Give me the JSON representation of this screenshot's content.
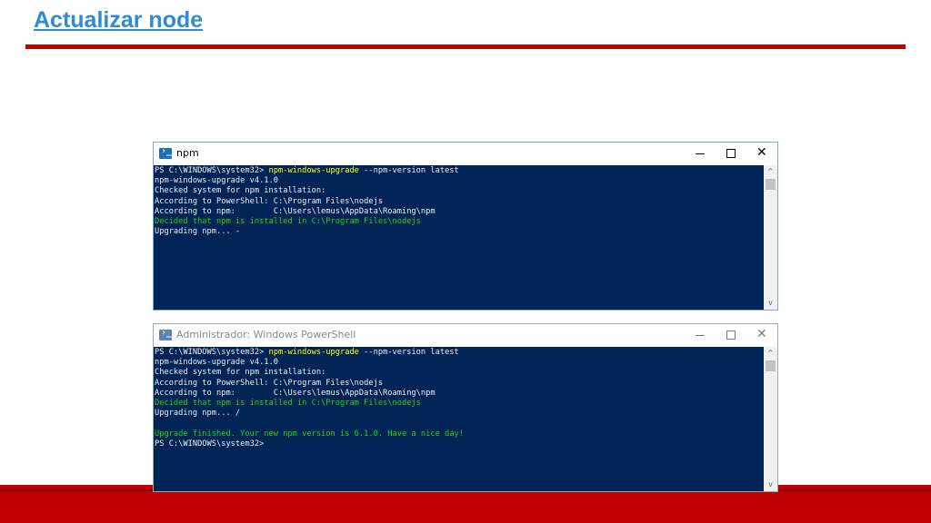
{
  "slide": {
    "title": "Actualizar node"
  },
  "windows": [
    {
      "title": "npm",
      "controls": {
        "minimize": "─",
        "maximize": "☐",
        "close": "✕"
      },
      "lines": [
        {
          "prompt": "PS C:\\WINDOWS\\system32> ",
          "command": "npm-windows-upgrade",
          "args": " --npm-version latest"
        },
        {
          "text": "npm-windows-upgrade v4.1.0"
        },
        {
          "text": "Checked system for npm installation:"
        },
        {
          "text": "According to PowerShell: C:\\Program Files\\nodejs"
        },
        {
          "text": "According to npm:        C:\\Users\\lemus\\AppData\\Roaming\\npm"
        },
        {
          "green": "Decided that npm is installed in C:\\Program Files\\nodejs"
        },
        {
          "text": "Upgrading npm... -"
        }
      ]
    },
    {
      "title": "Administrador: Windows PowerShell",
      "controls": {
        "minimize": "─",
        "maximize": "☐",
        "close": "✕"
      },
      "lines": [
        {
          "prompt": "PS C:\\WINDOWS\\system32> ",
          "command": "npm-windows-upgrade",
          "args": " --npm-version latest"
        },
        {
          "text": "npm-windows-upgrade v4.1.0"
        },
        {
          "text": "Checked system for npm installation:"
        },
        {
          "text": "According to PowerShell: C:\\Program Files\\nodejs"
        },
        {
          "text": "According to npm:        C:\\Users\\lemus\\AppData\\Roaming\\npm"
        },
        {
          "green": "Decided that npm is installed in C:\\Program Files\\nodejs"
        },
        {
          "text": "Upgrading npm... /"
        },
        {
          "text": ""
        },
        {
          "green": "Upgrade finished. Your new npm version is 6.1.0. Have a nice day!"
        },
        {
          "text": "PS C:\\WINDOWS\\system32>"
        }
      ]
    }
  ],
  "colors": {
    "title_blue": "#2e8bd6",
    "accent_red": "#c00000",
    "console_bg": "#012456",
    "console_text": "#ededed",
    "command_yellow": "#ffff00",
    "success_green": "#1ee31e"
  }
}
